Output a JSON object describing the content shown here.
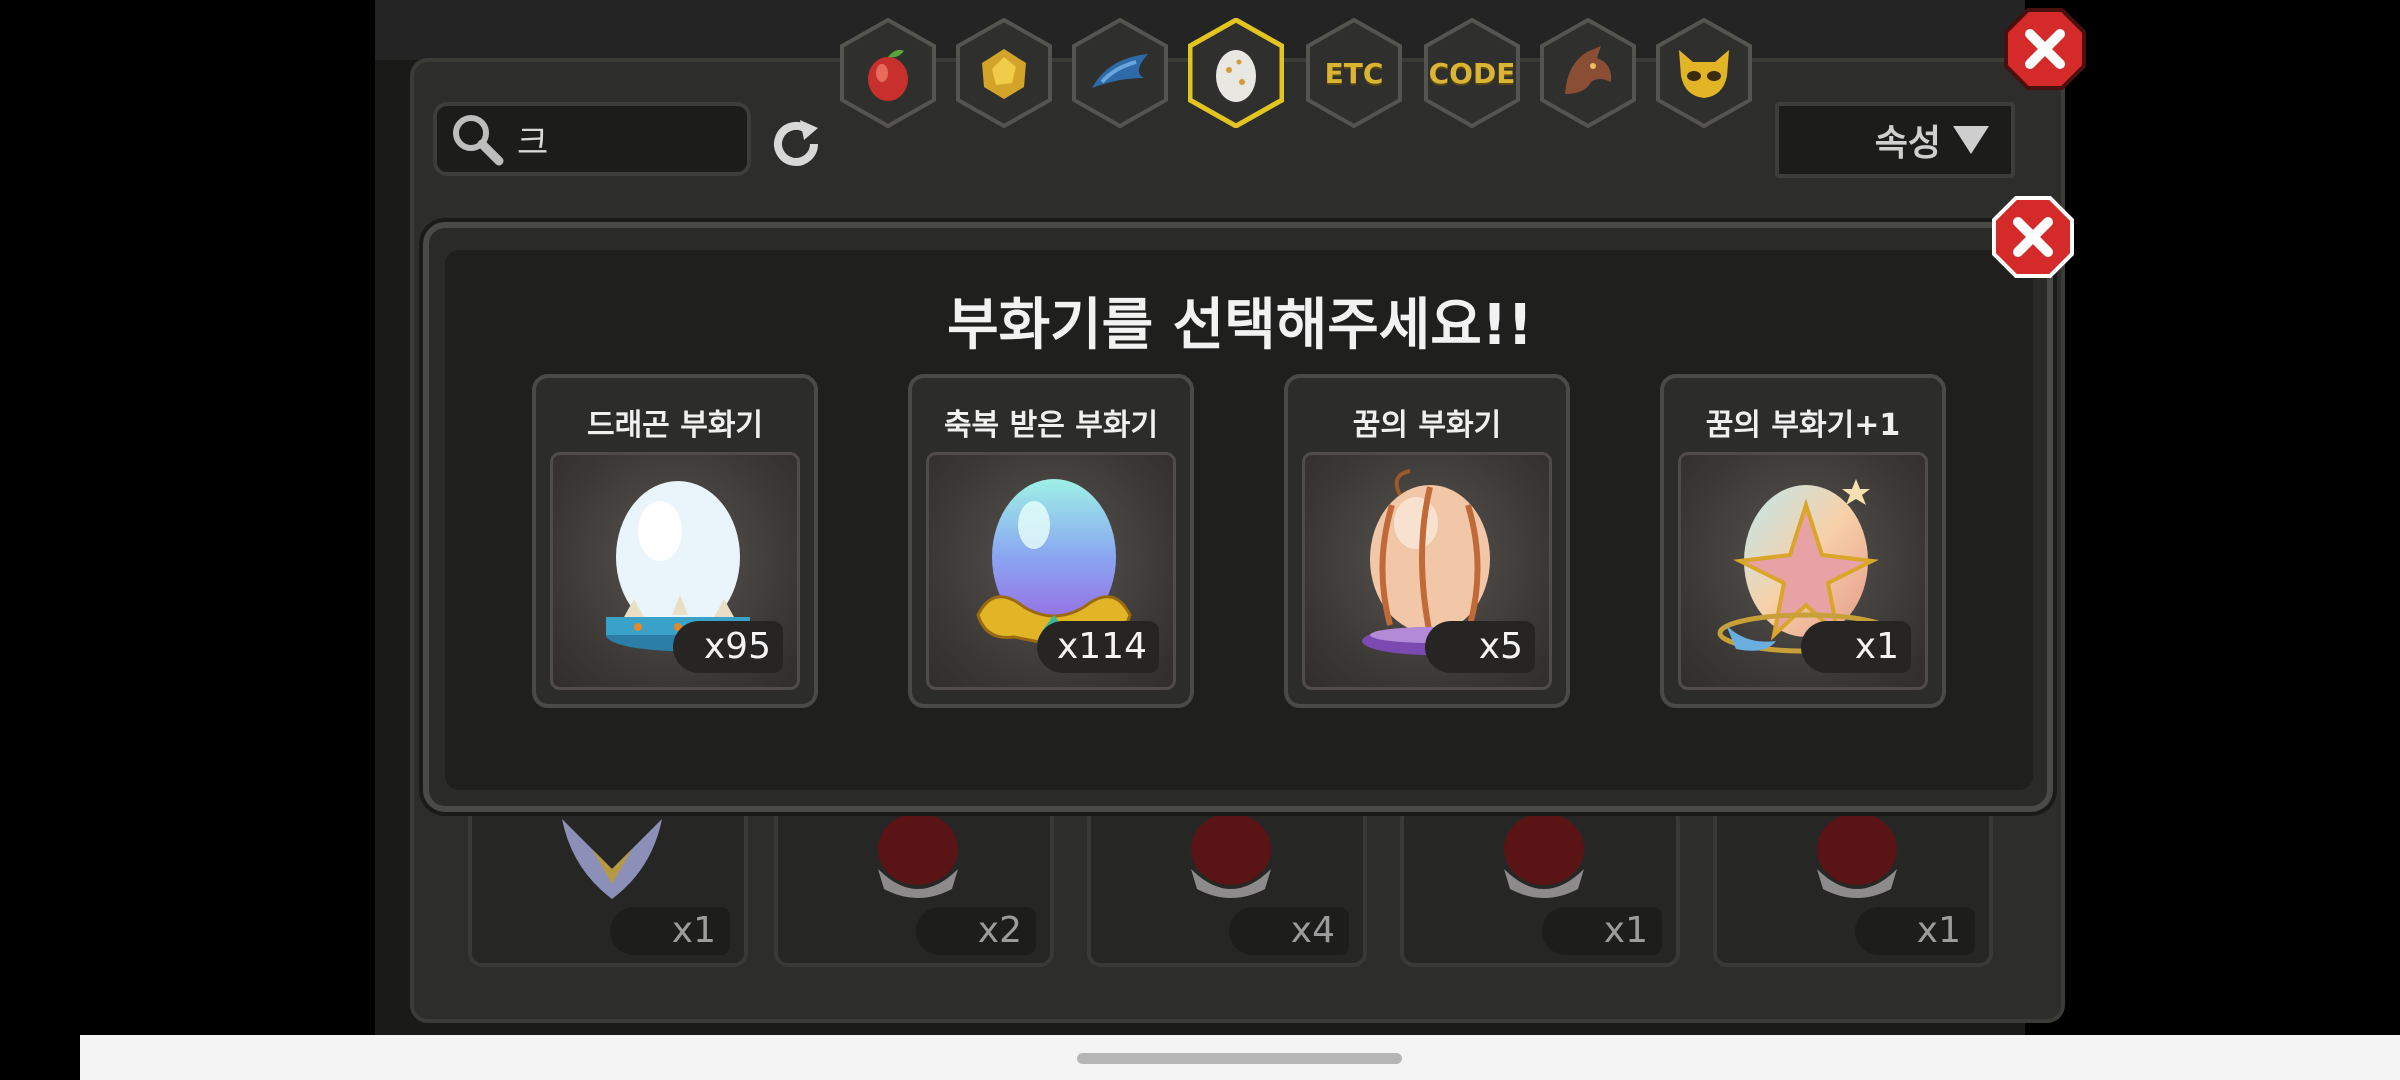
{
  "search": {
    "value": "크"
  },
  "attribute_filter": {
    "label": "속성"
  },
  "tabs": [
    {
      "icon": "fruit-icon",
      "label": ""
    },
    {
      "icon": "gold-ore-icon",
      "label": ""
    },
    {
      "icon": "blue-tail-icon",
      "label": ""
    },
    {
      "icon": "egg-icon",
      "label": "",
      "selected": true
    },
    {
      "icon": "etc-icon",
      "label": "ETC"
    },
    {
      "icon": "code-icon",
      "label": "CODE"
    },
    {
      "icon": "dragon-head-icon",
      "label": ""
    },
    {
      "icon": "mask-icon",
      "label": ""
    }
  ],
  "dialog": {
    "title": "부화기를 선택해주세요!!",
    "incubators": [
      {
        "name": "드래곤 부화기",
        "count": "x95",
        "icon": "dragon-incubator-egg-icon"
      },
      {
        "name": "축복 받은 부화기",
        "count": "x114",
        "icon": "blessed-incubator-egg-icon"
      },
      {
        "name": "꿈의 부화기",
        "count": "x5",
        "icon": "dream-incubator-egg-icon"
      },
      {
        "name": "꿈의 부화기+1",
        "count": "x1",
        "icon": "dream-incubator-plus-egg-icon"
      }
    ]
  },
  "background_slots": [
    {
      "count": "x1",
      "icon": "winged-emblem-icon"
    },
    {
      "count": "x2",
      "icon": "dark-egg-icon"
    },
    {
      "count": "x4",
      "icon": "dark-egg-icon"
    },
    {
      "count": "x1",
      "icon": "dark-egg-icon"
    },
    {
      "count": "x1",
      "icon": "dark-egg-icon"
    }
  ],
  "colors": {
    "accent_gold": "#d9b533",
    "close_red": "#d42a2a",
    "selected_tab_border": "#e2c521"
  }
}
